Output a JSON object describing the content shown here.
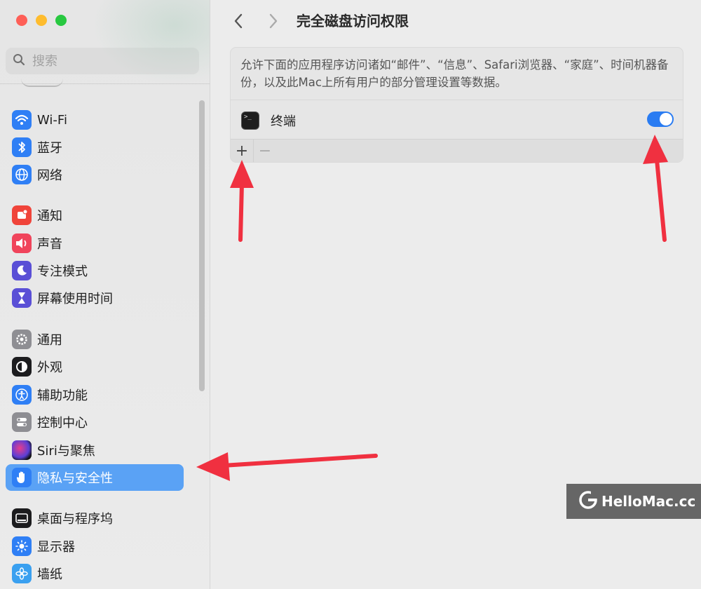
{
  "window": {
    "title": "完全磁盘访问权限",
    "traffic_lights": [
      "close",
      "minimize",
      "zoom"
    ]
  },
  "search": {
    "placeholder": "搜索",
    "value": ""
  },
  "sidebar": {
    "items": [
      {
        "label": "Wi-Fi",
        "icon": "wifi-icon",
        "color": "#2f7ff5"
      },
      {
        "label": "蓝牙",
        "icon": "bluetooth-icon",
        "color": "#2f7ff5"
      },
      {
        "label": "网络",
        "icon": "globe-icon",
        "color": "#2f7ff5"
      },
      {
        "label": "通知",
        "icon": "bell-icon",
        "color": "#f0443a"
      },
      {
        "label": "声音",
        "icon": "speaker-icon",
        "color": "#f0445b"
      },
      {
        "label": "专注模式",
        "icon": "moon-icon",
        "color": "#5a4fd6"
      },
      {
        "label": "屏幕使用时间",
        "icon": "hourglass-icon",
        "color": "#5a4fd6"
      },
      {
        "label": "通用",
        "icon": "gear-icon",
        "color": "#8e8e93"
      },
      {
        "label": "外观",
        "icon": "appearance-icon",
        "color": "#1c1c1e"
      },
      {
        "label": "辅助功能",
        "icon": "accessibility-icon",
        "color": "#2f7ff5"
      },
      {
        "label": "控制中心",
        "icon": "switches-icon",
        "color": "#8e8e93"
      },
      {
        "label": "Siri与聚焦",
        "icon": "siri-icon",
        "color": "#222222"
      },
      {
        "label": "隐私与安全性",
        "icon": "hand-icon",
        "color": "#2f7ff5",
        "selected": true
      },
      {
        "label": "桌面与程序坞",
        "icon": "dock-icon",
        "color": "#1c1c1e"
      },
      {
        "label": "显示器",
        "icon": "sun-icon",
        "color": "#2f7ff5"
      },
      {
        "label": "墙纸",
        "icon": "flower-icon",
        "color": "#3aa0f0"
      }
    ]
  },
  "main": {
    "description": "允许下面的应用程序访问诸如“邮件”、“信息”、Safari浏览器、“家庭”、时间机器备份，以及此Mac上所有用户的部分管理设置等数据。",
    "apps": [
      {
        "name": "终端",
        "icon": "terminal-icon",
        "enabled": true
      }
    ],
    "add_label": "+",
    "remove_label": "−"
  },
  "watermark": {
    "text": "HelloMac.cc"
  },
  "annotations": {
    "arrow_color": "#f03040"
  }
}
